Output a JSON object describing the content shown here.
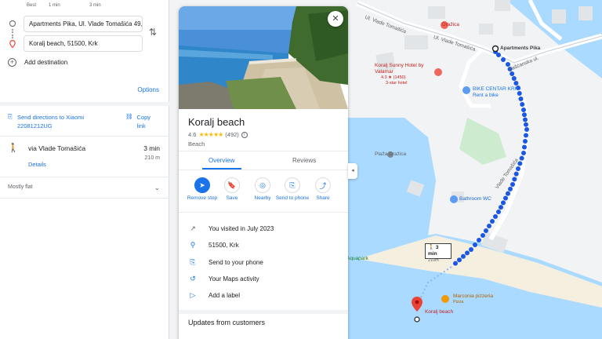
{
  "directions": {
    "modes": [
      {
        "label": "Best",
        "time": "1 min"
      },
      {
        "label": "",
        "time": "3 min"
      }
    ],
    "origin": "Apartments Pika, Ul. Vlade Tomašića 49,",
    "destination": "Koralj beach, 51500, Krk",
    "add_destination": "Add destination",
    "options": "Options",
    "send_directions": "Send directions to Xiaomi 22081212UG",
    "copy_link": "Copy link",
    "route": {
      "via": "via Vlade Tomašića",
      "time": "3 min",
      "distance": "210 m",
      "details": "Details"
    },
    "terrain": "Mostly flat"
  },
  "place": {
    "name": "Koralj beach",
    "rating": "4.6",
    "reviews_count": "(492)",
    "category": "Beach",
    "tabs": [
      "Overview",
      "Reviews"
    ],
    "actions": [
      {
        "label": "Remove stop",
        "icon": "remove-stop-icon"
      },
      {
        "label": "Save",
        "icon": "bookmark-icon"
      },
      {
        "label": "Nearby",
        "icon": "nearby-icon"
      },
      {
        "label": "Send to phone",
        "icon": "send-to-phone-icon"
      },
      {
        "label": "Share",
        "icon": "share-icon"
      }
    ],
    "info": [
      {
        "icon": "trend-icon",
        "text": "You visited in July 2023"
      },
      {
        "icon": "location-pin-icon",
        "text": "51500, Krk"
      },
      {
        "icon": "send-to-phone-icon",
        "text": "Send to your phone"
      },
      {
        "icon": "history-icon",
        "text": "Your Maps activity"
      },
      {
        "icon": "label-icon",
        "text": "Add a label"
      }
    ],
    "updates_heading": "Updates from customers"
  },
  "map": {
    "labels": {
      "drazica": "Dražica",
      "apartments": "Apartments Pika",
      "street1": "Ul. Vlade Tomašića",
      "street2": "Ul. Vlade Tomašića",
      "street3": "Vlade Tomašića",
      "street4": "Bašćanska ul.",
      "hotel_name": "Koralj Sunny Hotel by Valamar",
      "hotel_rating": "4.3 ★ (1450)",
      "hotel_class": "3-star hotel",
      "bike": "BIKE CENTAR KRK - Rent a bike",
      "bathroom": "Bathroom WC",
      "pizzeria": "Marconia pizzeria",
      "pizzeria_type": "Pizza",
      "koralj": "Koralj beach",
      "beach_small": "Plaža Dražica",
      "park": "Aquapark"
    },
    "walk_badge": {
      "time": "3 min",
      "distance": "210m"
    }
  },
  "colors": {
    "accent": "#1a73e8",
    "route": "#1a57e6",
    "water": "#aadaff",
    "pin": "#ea4335"
  }
}
